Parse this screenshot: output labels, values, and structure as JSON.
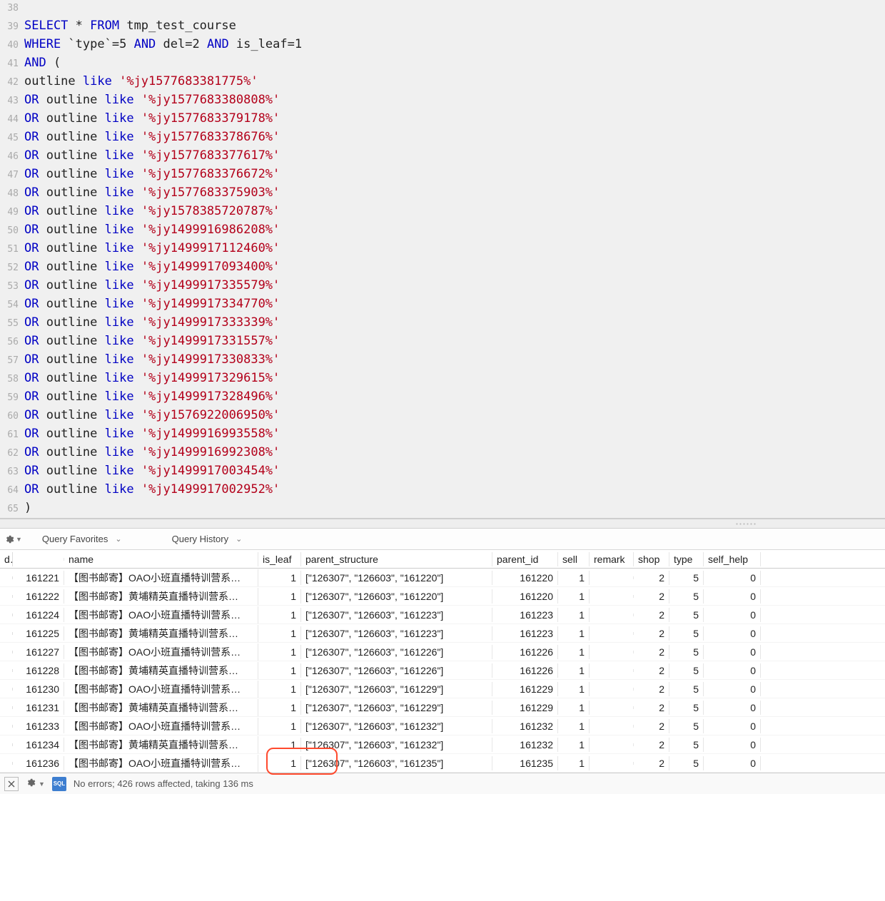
{
  "editor": {
    "lines": [
      {
        "n": 38,
        "tokens": []
      },
      {
        "n": 39,
        "tokens": [
          [
            "kw",
            "SELECT"
          ],
          [
            "op",
            " * "
          ],
          [
            "kw",
            "FROM"
          ],
          [
            "ident",
            " tmp_test_course"
          ]
        ]
      },
      {
        "n": 40,
        "tokens": [
          [
            "kw",
            "WHERE"
          ],
          [
            "op",
            " `"
          ],
          [
            "ident",
            "type"
          ],
          [
            "op",
            "`=5 "
          ],
          [
            "kw",
            "AND"
          ],
          [
            "ident",
            " del"
          ],
          [
            "op",
            "=2 "
          ],
          [
            "kw",
            "AND"
          ],
          [
            "ident",
            " is_leaf"
          ],
          [
            "op",
            "=1"
          ]
        ]
      },
      {
        "n": 41,
        "tokens": [
          [
            "kw",
            "AND"
          ],
          [
            "op",
            " ("
          ]
        ]
      },
      {
        "n": 42,
        "tokens": [
          [
            "ident",
            "outline "
          ],
          [
            "like",
            "like"
          ],
          [
            "op",
            " "
          ],
          [
            "str",
            "'%jy1577683381775%'"
          ]
        ]
      },
      {
        "n": 43,
        "tokens": [
          [
            "kw",
            "OR"
          ],
          [
            "ident",
            " outline "
          ],
          [
            "like",
            "like"
          ],
          [
            "op",
            " "
          ],
          [
            "str",
            "'%jy1577683380808%'"
          ]
        ]
      },
      {
        "n": 44,
        "tokens": [
          [
            "kw",
            "OR"
          ],
          [
            "ident",
            " outline "
          ],
          [
            "like",
            "like"
          ],
          [
            "op",
            " "
          ],
          [
            "str",
            "'%jy1577683379178%'"
          ]
        ]
      },
      {
        "n": 45,
        "tokens": [
          [
            "kw",
            "OR"
          ],
          [
            "ident",
            " outline "
          ],
          [
            "like",
            "like"
          ],
          [
            "op",
            " "
          ],
          [
            "str",
            "'%jy1577683378676%'"
          ]
        ]
      },
      {
        "n": 46,
        "tokens": [
          [
            "kw",
            "OR"
          ],
          [
            "ident",
            " outline "
          ],
          [
            "like",
            "like"
          ],
          [
            "op",
            " "
          ],
          [
            "str",
            "'%jy1577683377617%'"
          ]
        ]
      },
      {
        "n": 47,
        "tokens": [
          [
            "kw",
            "OR"
          ],
          [
            "ident",
            " outline "
          ],
          [
            "like",
            "like"
          ],
          [
            "op",
            " "
          ],
          [
            "str",
            "'%jy1577683376672%'"
          ]
        ]
      },
      {
        "n": 48,
        "tokens": [
          [
            "kw",
            "OR"
          ],
          [
            "ident",
            " outline "
          ],
          [
            "like",
            "like"
          ],
          [
            "op",
            " "
          ],
          [
            "str",
            "'%jy1577683375903%'"
          ]
        ]
      },
      {
        "n": 49,
        "tokens": [
          [
            "kw",
            "OR"
          ],
          [
            "ident",
            " outline "
          ],
          [
            "like",
            "like"
          ],
          [
            "op",
            " "
          ],
          [
            "str",
            "'%jy1578385720787%'"
          ]
        ]
      },
      {
        "n": 50,
        "tokens": [
          [
            "kw",
            "OR"
          ],
          [
            "ident",
            " outline "
          ],
          [
            "like",
            "like"
          ],
          [
            "op",
            " "
          ],
          [
            "str",
            "'%jy1499916986208%'"
          ]
        ]
      },
      {
        "n": 51,
        "tokens": [
          [
            "kw",
            "OR"
          ],
          [
            "ident",
            " outline "
          ],
          [
            "like",
            "like"
          ],
          [
            "op",
            " "
          ],
          [
            "str",
            "'%jy1499917112460%'"
          ]
        ]
      },
      {
        "n": 52,
        "tokens": [
          [
            "kw",
            "OR"
          ],
          [
            "ident",
            " outline "
          ],
          [
            "like",
            "like"
          ],
          [
            "op",
            " "
          ],
          [
            "str",
            "'%jy1499917093400%'"
          ]
        ]
      },
      {
        "n": 53,
        "tokens": [
          [
            "kw",
            "OR"
          ],
          [
            "ident",
            " outline "
          ],
          [
            "like",
            "like"
          ],
          [
            "op",
            " "
          ],
          [
            "str",
            "'%jy1499917335579%'"
          ]
        ]
      },
      {
        "n": 54,
        "tokens": [
          [
            "kw",
            "OR"
          ],
          [
            "ident",
            " outline "
          ],
          [
            "like",
            "like"
          ],
          [
            "op",
            " "
          ],
          [
            "str",
            "'%jy1499917334770%'"
          ]
        ]
      },
      {
        "n": 55,
        "tokens": [
          [
            "kw",
            "OR"
          ],
          [
            "ident",
            " outline "
          ],
          [
            "like",
            "like"
          ],
          [
            "op",
            " "
          ],
          [
            "str",
            "'%jy1499917333339%'"
          ]
        ]
      },
      {
        "n": 56,
        "tokens": [
          [
            "kw",
            "OR"
          ],
          [
            "ident",
            " outline "
          ],
          [
            "like",
            "like"
          ],
          [
            "op",
            " "
          ],
          [
            "str",
            "'%jy1499917331557%'"
          ]
        ]
      },
      {
        "n": 57,
        "tokens": [
          [
            "kw",
            "OR"
          ],
          [
            "ident",
            " outline "
          ],
          [
            "like",
            "like"
          ],
          [
            "op",
            " "
          ],
          [
            "str",
            "'%jy1499917330833%'"
          ]
        ]
      },
      {
        "n": 58,
        "tokens": [
          [
            "kw",
            "OR"
          ],
          [
            "ident",
            " outline "
          ],
          [
            "like",
            "like"
          ],
          [
            "op",
            " "
          ],
          [
            "str",
            "'%jy1499917329615%'"
          ]
        ]
      },
      {
        "n": 59,
        "tokens": [
          [
            "kw",
            "OR"
          ],
          [
            "ident",
            " outline "
          ],
          [
            "like",
            "like"
          ],
          [
            "op",
            " "
          ],
          [
            "str",
            "'%jy1499917328496%'"
          ]
        ]
      },
      {
        "n": 60,
        "tokens": [
          [
            "kw",
            "OR"
          ],
          [
            "ident",
            " outline "
          ],
          [
            "like",
            "like"
          ],
          [
            "op",
            " "
          ],
          [
            "str",
            "'%jy1576922006950%'"
          ]
        ]
      },
      {
        "n": 61,
        "tokens": [
          [
            "kw",
            "OR"
          ],
          [
            "ident",
            " outline "
          ],
          [
            "like",
            "like"
          ],
          [
            "op",
            " "
          ],
          [
            "str",
            "'%jy1499916993558%'"
          ]
        ]
      },
      {
        "n": 62,
        "tokens": [
          [
            "kw",
            "OR"
          ],
          [
            "ident",
            " outline "
          ],
          [
            "like",
            "like"
          ],
          [
            "op",
            " "
          ],
          [
            "str",
            "'%jy1499916992308%'"
          ]
        ]
      },
      {
        "n": 63,
        "tokens": [
          [
            "kw",
            "OR"
          ],
          [
            "ident",
            " outline "
          ],
          [
            "like",
            "like"
          ],
          [
            "op",
            " "
          ],
          [
            "str",
            "'%jy1499917003454%'"
          ]
        ]
      },
      {
        "n": 64,
        "tokens": [
          [
            "kw",
            "OR"
          ],
          [
            "ident",
            " outline "
          ],
          [
            "like",
            "like"
          ],
          [
            "op",
            " "
          ],
          [
            "str",
            "'%jy1499917002952%'"
          ]
        ]
      },
      {
        "n": 65,
        "tokens": [
          [
            "op",
            ")"
          ]
        ]
      }
    ]
  },
  "toolbar": {
    "favorites": "Query Favorites",
    "history": "Query History"
  },
  "results": {
    "columns": {
      "d": "d",
      "id_blank": "",
      "name": "name",
      "is_leaf": "is_leaf",
      "parent_structure": "parent_structure",
      "parent_id": "parent_id",
      "sell": "sell",
      "remark": "remark",
      "shop": "shop",
      "type": "type",
      "self_help": "self_help"
    },
    "rows": [
      {
        "id": "161221",
        "name": "【图书邮寄】OAO小班直播特训营系…",
        "is_leaf": "1",
        "ps": "[\"126307\", \"126603\", \"161220\"]",
        "pid": "161220",
        "sell": "1",
        "remark": "",
        "shop": "2",
        "type": "5",
        "self": "0"
      },
      {
        "id": "161222",
        "name": "【图书邮寄】黄埔精英直播特训营系…",
        "is_leaf": "1",
        "ps": "[\"126307\", \"126603\", \"161220\"]",
        "pid": "161220",
        "sell": "1",
        "remark": "",
        "shop": "2",
        "type": "5",
        "self": "0"
      },
      {
        "id": "161224",
        "name": "【图书邮寄】OAO小班直播特训营系…",
        "is_leaf": "1",
        "ps": "[\"126307\", \"126603\", \"161223\"]",
        "pid": "161223",
        "sell": "1",
        "remark": "",
        "shop": "2",
        "type": "5",
        "self": "0"
      },
      {
        "id": "161225",
        "name": "【图书邮寄】黄埔精英直播特训营系…",
        "is_leaf": "1",
        "ps": "[\"126307\", \"126603\", \"161223\"]",
        "pid": "161223",
        "sell": "1",
        "remark": "",
        "shop": "2",
        "type": "5",
        "self": "0"
      },
      {
        "id": "161227",
        "name": "【图书邮寄】OAO小班直播特训营系…",
        "is_leaf": "1",
        "ps": "[\"126307\", \"126603\", \"161226\"]",
        "pid": "161226",
        "sell": "1",
        "remark": "",
        "shop": "2",
        "type": "5",
        "self": "0"
      },
      {
        "id": "161228",
        "name": "【图书邮寄】黄埔精英直播特训营系…",
        "is_leaf": "1",
        "ps": "[\"126307\", \"126603\", \"161226\"]",
        "pid": "161226",
        "sell": "1",
        "remark": "",
        "shop": "2",
        "type": "5",
        "self": "0"
      },
      {
        "id": "161230",
        "name": "【图书邮寄】OAO小班直播特训营系…",
        "is_leaf": "1",
        "ps": "[\"126307\", \"126603\", \"161229\"]",
        "pid": "161229",
        "sell": "1",
        "remark": "",
        "shop": "2",
        "type": "5",
        "self": "0"
      },
      {
        "id": "161231",
        "name": "【图书邮寄】黄埔精英直播特训营系…",
        "is_leaf": "1",
        "ps": "[\"126307\", \"126603\", \"161229\"]",
        "pid": "161229",
        "sell": "1",
        "remark": "",
        "shop": "2",
        "type": "5",
        "self": "0"
      },
      {
        "id": "161233",
        "name": "【图书邮寄】OAO小班直播特训营系…",
        "is_leaf": "1",
        "ps": "[\"126307\", \"126603\", \"161232\"]",
        "pid": "161232",
        "sell": "1",
        "remark": "",
        "shop": "2",
        "type": "5",
        "self": "0"
      },
      {
        "id": "161234",
        "name": "【图书邮寄】黄埔精英直播特训营系…",
        "is_leaf": "1",
        "ps": "[\"126307\", \"126603\", \"161232\"]",
        "pid": "161232",
        "sell": "1",
        "remark": "",
        "shop": "2",
        "type": "5",
        "self": "0"
      },
      {
        "id": "161236",
        "name": "【图书邮寄】OAO小班直播特训营系…",
        "is_leaf": "1",
        "ps": "[\"126307\", \"126603\", \"161235\"]",
        "pid": "161235",
        "sell": "1",
        "remark": "",
        "shop": "2",
        "type": "5",
        "self": "0"
      }
    ]
  },
  "status": {
    "message": "No errors; 426 rows affected, taking 136 ms"
  }
}
